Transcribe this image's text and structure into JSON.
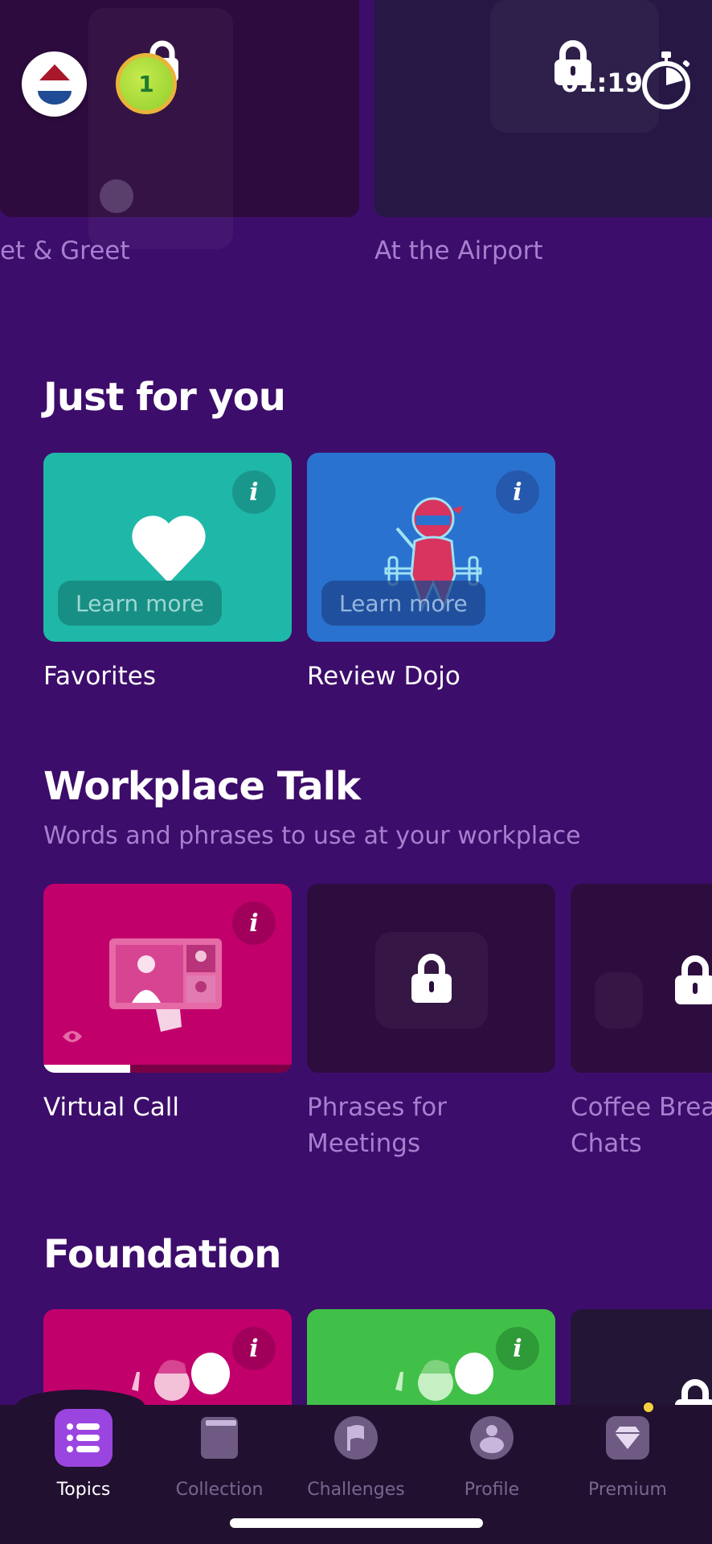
{
  "header": {
    "language_flag": "netherlands-flag",
    "level_medal": "1",
    "timer": "01:19"
  },
  "hero": {
    "cards": [
      {
        "label": "et & Greet",
        "locked": false
      },
      {
        "label": "At the Airport",
        "locked": true
      }
    ]
  },
  "just_for_you": {
    "title": "Just for you",
    "cards": [
      {
        "label": "Favorites",
        "button": "Learn more",
        "info": "i",
        "color": "#1fb8a8"
      },
      {
        "label": "Review Dojo",
        "button": "Learn more",
        "info": "i",
        "color": "#2a72cf"
      }
    ]
  },
  "workplace_talk": {
    "title": "Workplace Talk",
    "subtitle": "Words and phrases to use at your workplace",
    "cards": [
      {
        "label": "Virtual Call",
        "locked": false,
        "info": "i",
        "progress_percent": 35,
        "color": "#c2006c"
      },
      {
        "label_line1": "Phrases for",
        "label_line2": "Meetings",
        "locked": true
      },
      {
        "label_line1": "Coffee Break",
        "label_line2": "Chats",
        "locked": true
      }
    ]
  },
  "foundation": {
    "title": "Foundation",
    "cards": [
      {
        "info": "i",
        "color": "#c2006c",
        "locked": false
      },
      {
        "info": "i",
        "color": "#40c048",
        "locked": false
      },
      {
        "locked": true
      }
    ]
  },
  "nav": {
    "items": [
      {
        "label": "Topics",
        "icon": "list-icon",
        "active": true
      },
      {
        "label": "Collection",
        "icon": "book-icon",
        "active": false
      },
      {
        "label": "Challenges",
        "icon": "flag-icon",
        "active": false
      },
      {
        "label": "Profile",
        "icon": "person-icon",
        "active": false
      },
      {
        "label": "Premium",
        "icon": "diamond-icon",
        "active": false,
        "badge": true
      }
    ]
  },
  "colors": {
    "background": "#3d0d6b",
    "accent": "#9b45e0",
    "muted_text": "#a77fcf",
    "nav_bg": "#21102f",
    "badge": "#f4d03f"
  }
}
